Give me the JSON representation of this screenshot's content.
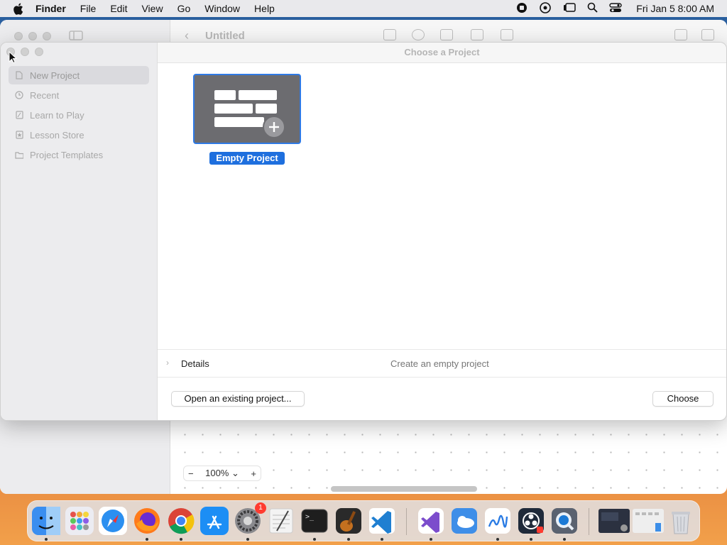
{
  "menubar": {
    "app": "Finder",
    "items": [
      "File",
      "Edit",
      "View",
      "Go",
      "Window",
      "Help"
    ],
    "clock": "Fri Jan 5  8:00 AM"
  },
  "back_window": {
    "title": "Untitled",
    "zoom_level": "100%",
    "zoom_minus": "−",
    "zoom_plus": "+"
  },
  "dialog": {
    "title": "Choose a Project",
    "sidebar": [
      {
        "label": "New Project",
        "icon": "document-icon"
      },
      {
        "label": "Recent",
        "icon": "clock-icon"
      },
      {
        "label": "Learn to Play",
        "icon": "book-icon"
      },
      {
        "label": "Lesson Store",
        "icon": "star-icon"
      },
      {
        "label": "Project Templates",
        "icon": "folder-icon"
      }
    ],
    "selected_template": "Empty Project",
    "details_label": "Details",
    "details_description": "Create an empty project",
    "open_existing_label": "Open an existing project...",
    "choose_label": "Choose"
  },
  "dock": {
    "apps": [
      {
        "name": "finder-icon",
        "color": "#3a8ef0"
      },
      {
        "name": "launchpad-icon",
        "color": "#e8e8ee"
      },
      {
        "name": "safari-icon",
        "color": "#2b8ff0"
      },
      {
        "name": "firefox-icon",
        "color": "#ff7a1a"
      },
      {
        "name": "chrome-icon",
        "color": "#ffffff"
      },
      {
        "name": "app-store-icon",
        "color": "#1c8ef5"
      },
      {
        "name": "system-settings-icon",
        "color": "#8a8a8e"
      },
      {
        "name": "textedit-icon",
        "color": "#f3f3f3"
      },
      {
        "name": "terminal-icon",
        "color": "#1e1e1e"
      },
      {
        "name": "garageband-icon",
        "color": "#c4701f"
      },
      {
        "name": "vscode-icon",
        "color": "#ffffff"
      },
      {
        "name": "visual-studio-icon",
        "color": "#ffffff"
      },
      {
        "name": "weather-icon",
        "color": "#3e8ee8"
      },
      {
        "name": "freeform-icon",
        "color": "#ffffff"
      },
      {
        "name": "obs-icon",
        "color": "#1f2a3a"
      },
      {
        "name": "quicktime-icon",
        "color": "#5a6270"
      },
      {
        "name": "screenshot-thumbnail-1",
        "color": "#2b3140"
      },
      {
        "name": "screenshot-thumbnail-2",
        "color": "#eeeeee"
      },
      {
        "name": "trash-icon",
        "color": "#d9dbe0"
      }
    ],
    "settings_badge": "1"
  },
  "colors": {
    "selection_blue": "#1e6fde",
    "tile_gray": "#6c6c70"
  }
}
